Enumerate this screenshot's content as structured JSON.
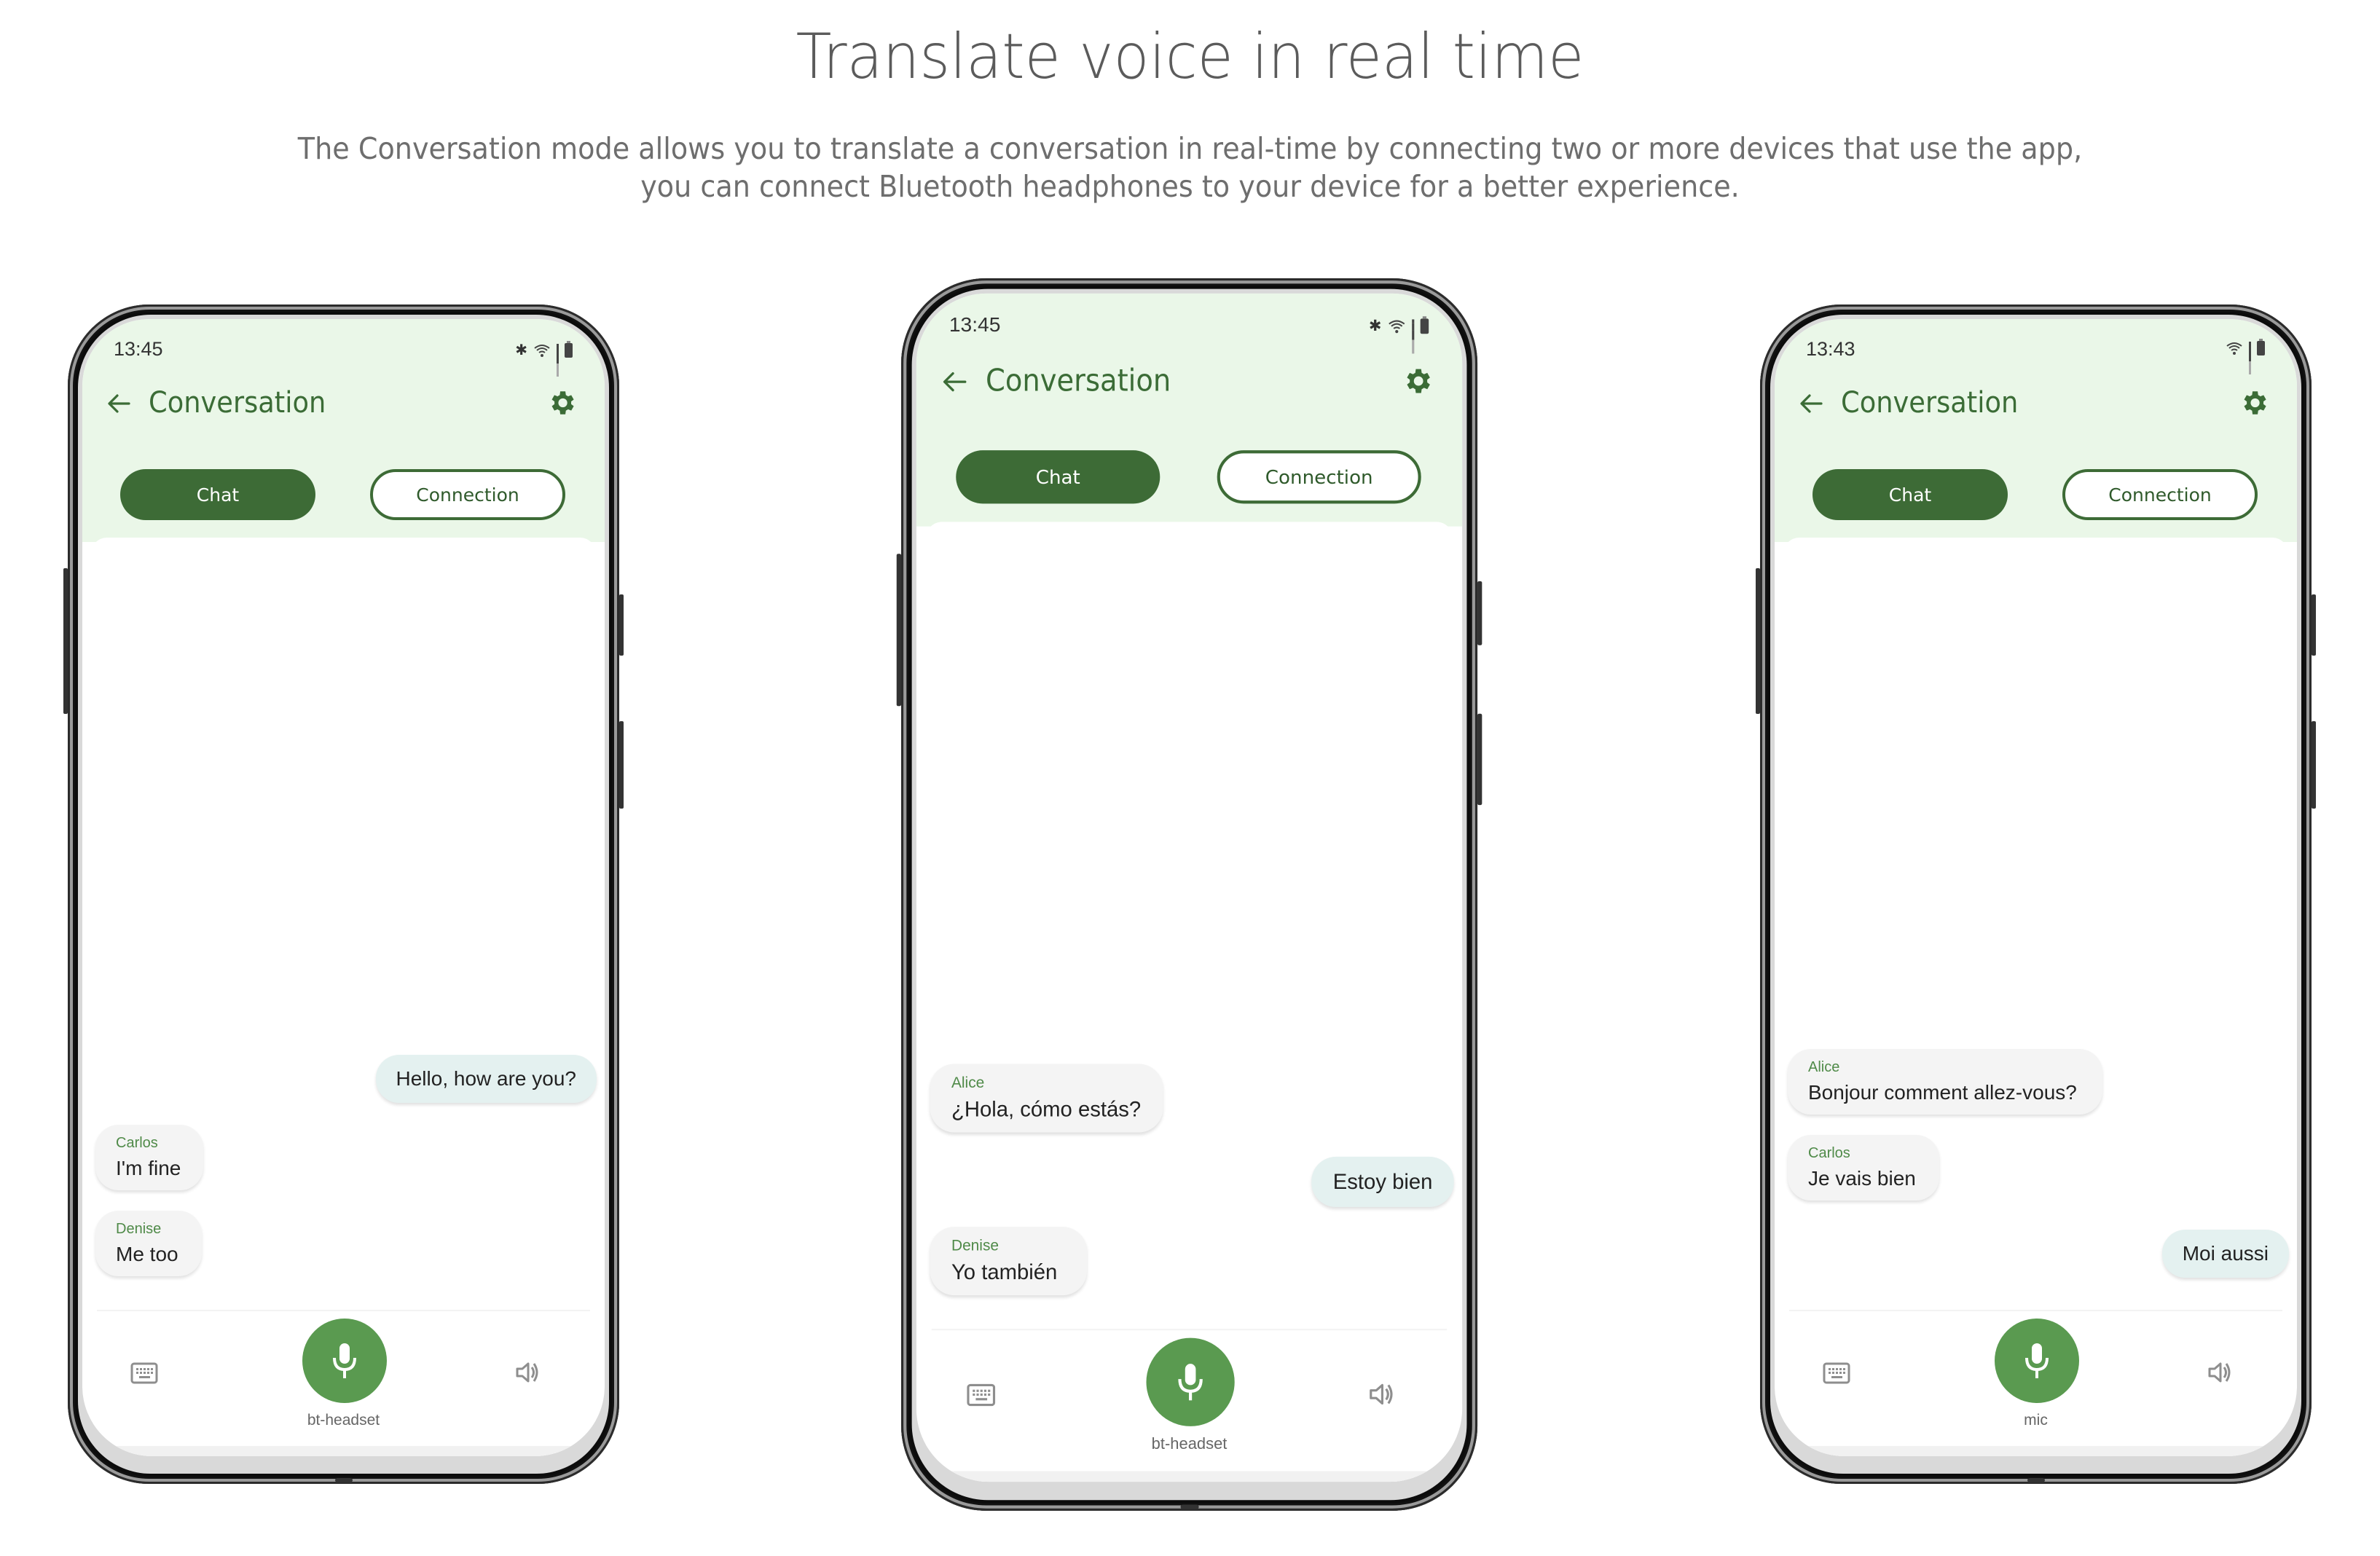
{
  "hero": {
    "title": "Translate voice in real time",
    "subtitle_line1": "The Conversation mode allows you to translate a conversation in real-time by connecting two or more devices that use the app,",
    "subtitle_line2": "you can connect Bluetooth headphones to your device for a better experience."
  },
  "colors": {
    "accent_green": "#3d6b36",
    "header_bg": "#eaf7e8",
    "mic_green": "#5a9a50",
    "own_bubble": "#e4f1f0",
    "other_bubble": "#f4f4f4",
    "sender_name": "#4f8a48"
  },
  "phones": [
    {
      "status_time": "13:45",
      "status_icons": [
        "bluetooth-icon",
        "wifi-icon",
        "signal-icon",
        "battery-charging-icon"
      ],
      "app_title": "Conversation",
      "tabs": {
        "chat": "Chat",
        "connection": "Connection",
        "active": "chat"
      },
      "messages": [
        {
          "sender": "",
          "text": "Hello, how are you?",
          "own": true
        },
        {
          "sender": "Carlos",
          "text": "I'm fine",
          "own": false
        },
        {
          "sender": "Denise",
          "text": "Me too",
          "own": false
        }
      ],
      "mic_label": "bt-headset"
    },
    {
      "status_time": "13:45",
      "status_icons": [
        "bluetooth-icon",
        "wifi-icon",
        "signal-icon",
        "battery-charging-icon"
      ],
      "app_title": "Conversation",
      "tabs": {
        "chat": "Chat",
        "connection": "Connection",
        "active": "chat"
      },
      "messages": [
        {
          "sender": "Alice",
          "text": "¿Hola, cómo estás?",
          "own": false
        },
        {
          "sender": "",
          "text": "Estoy bien",
          "own": true
        },
        {
          "sender": "Denise",
          "text": "Yo también",
          "own": false
        }
      ],
      "mic_label": "bt-headset"
    },
    {
      "status_time": "13:43",
      "status_icons": [
        "wifi-icon",
        "signal-icon",
        "battery-charging-icon"
      ],
      "app_title": "Conversation",
      "tabs": {
        "chat": "Chat",
        "connection": "Connection",
        "active": "chat"
      },
      "messages": [
        {
          "sender": "Alice",
          "text": "Bonjour comment allez-vous?",
          "own": false
        },
        {
          "sender": "Carlos",
          "text": "Je vais bien",
          "own": false
        },
        {
          "sender": "",
          "text": "Moi aussi",
          "own": true
        }
      ],
      "mic_label": "mic"
    }
  ]
}
